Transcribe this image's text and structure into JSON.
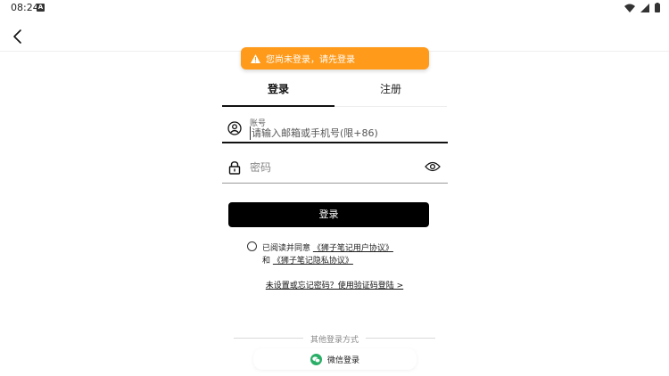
{
  "status_bar": {
    "time": "08:24",
    "notification_icon": "A"
  },
  "toast": {
    "message": "您尚未登录，请先登录",
    "color": "#ff9a1a"
  },
  "tabs": [
    {
      "label": "登录",
      "active": true
    },
    {
      "label": "注册",
      "active": false
    }
  ],
  "account_field": {
    "label": "账号",
    "placeholder": "请输入邮箱或手机号(限+86)"
  },
  "password_field": {
    "placeholder": "密码"
  },
  "login_button": {
    "label": "登录"
  },
  "agreement": {
    "prefix": "已阅读并同意",
    "user_agreement": "《狮子笔记用户协议》",
    "and": "和",
    "privacy_agreement": "《狮子笔记隐私协议》",
    "checked": false
  },
  "forgot_link": "未设置或忘记密码？使用验证码登陆 >",
  "other_login": {
    "divider_text": "其他登录方式",
    "wechat_label": "微信登录",
    "wechat_color": "#2aae67"
  }
}
